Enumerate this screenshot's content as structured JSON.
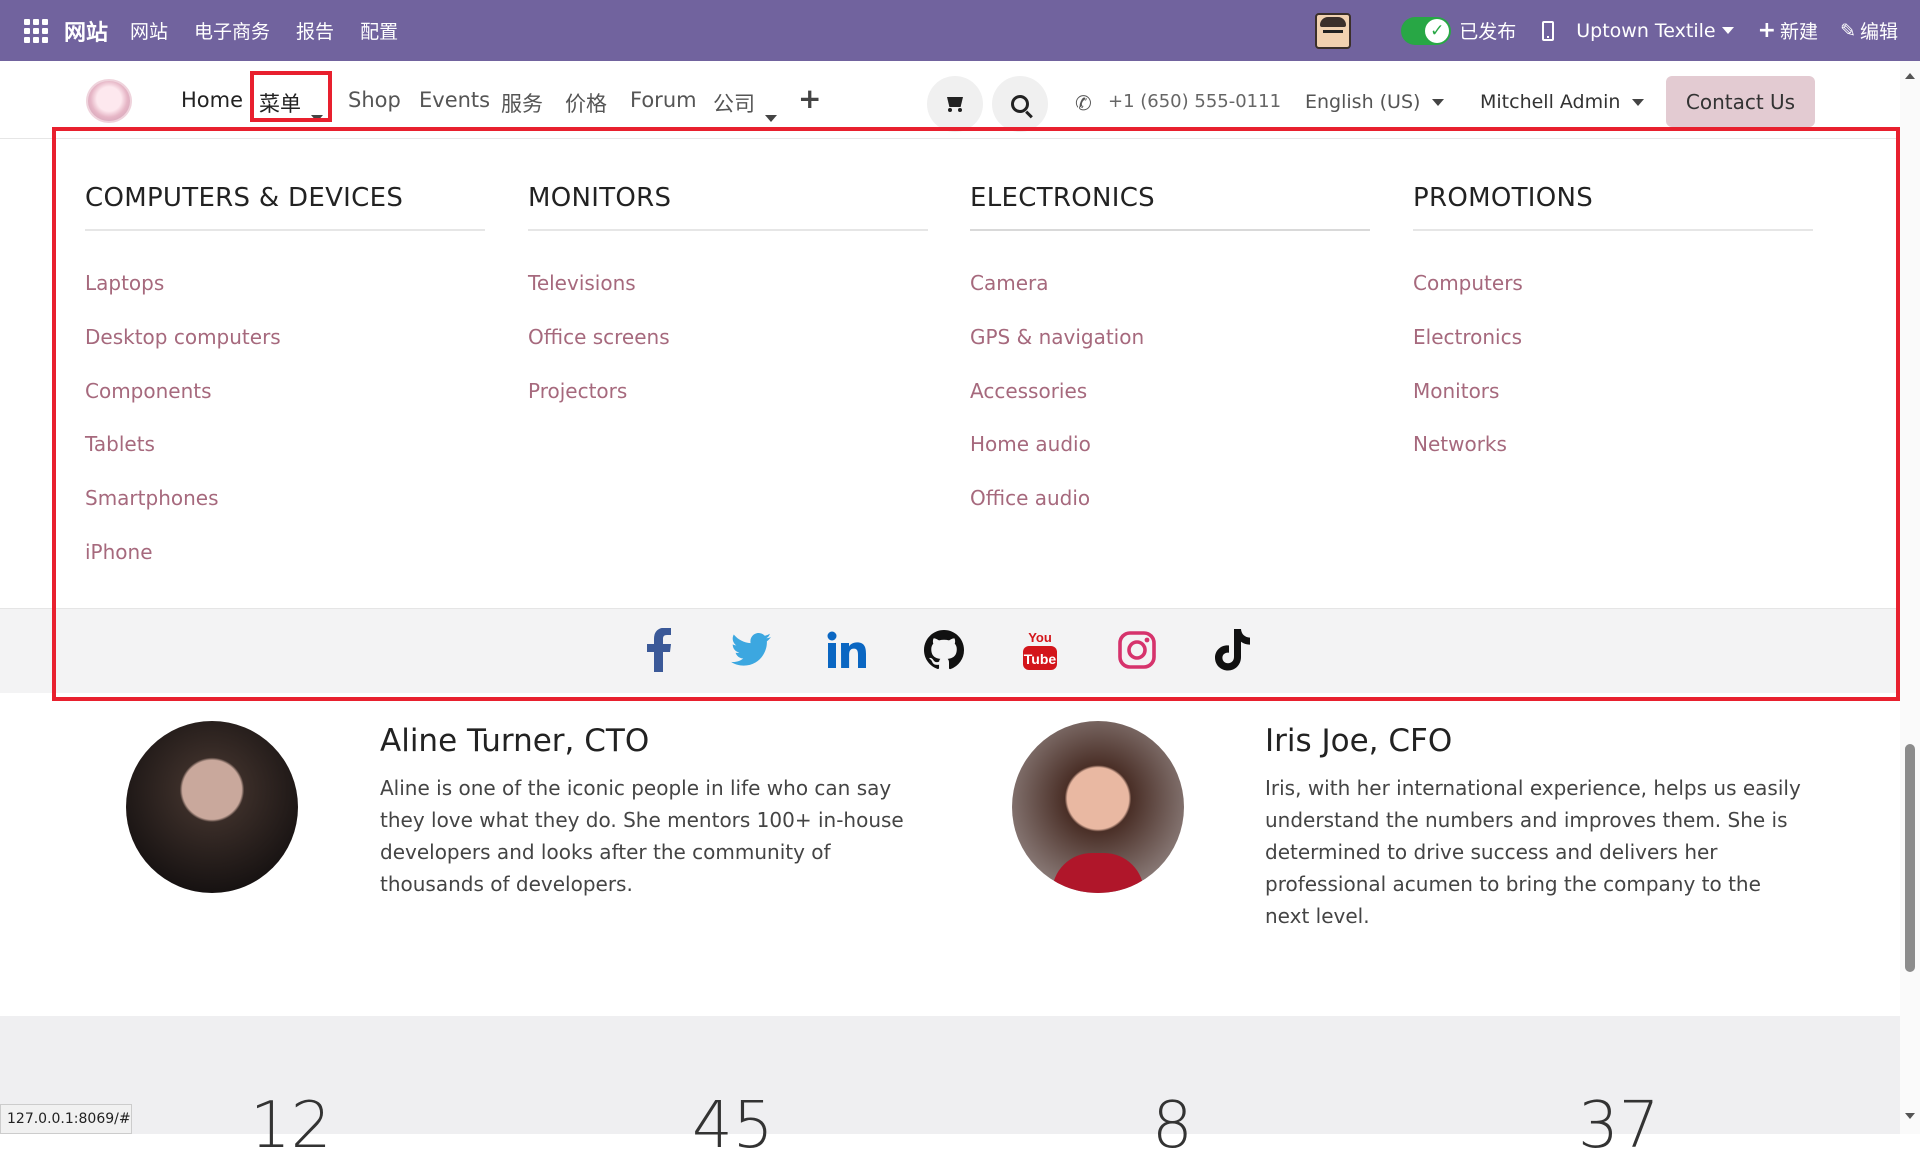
{
  "admin_bar": {
    "brand": "网站",
    "menus": [
      "网站",
      "电子商务",
      "报告",
      "配置"
    ],
    "published": "已发布",
    "site": "Uptown Textile",
    "new": "新建",
    "edit": "编辑",
    "color": "#71639e"
  },
  "navbar": {
    "items": [
      "Home",
      "菜单",
      "Shop",
      "Events",
      "服务",
      "价格",
      "Forum",
      "公司"
    ],
    "phone": "+1 (650) 555-0111",
    "language": "English (US)",
    "user": "Mitchell Admin",
    "contact": "Contact Us",
    "highlighted_item": "菜单"
  },
  "mega_menu": {
    "columns": [
      {
        "title": "COMPUTERS & DEVICES",
        "items": [
          "Laptops",
          "Desktop computers",
          "Components",
          "Tablets",
          "Smartphones",
          "iPhone"
        ]
      },
      {
        "title": "MONITORS",
        "items": [
          "Televisions",
          "Office screens",
          "Projectors"
        ]
      },
      {
        "title": "ELECTRONICS",
        "items": [
          "Camera",
          "GPS & navigation",
          "Accessories",
          "Home audio",
          "Office audio"
        ]
      },
      {
        "title": "PROMOTIONS",
        "items": [
          "Computers",
          "Electronics",
          "Monitors",
          "Networks"
        ]
      }
    ],
    "social_icons": [
      "facebook-icon",
      "twitter-icon",
      "linkedin-icon",
      "github-icon",
      "youtube-icon",
      "instagram-icon",
      "tiktok-icon"
    ],
    "link_color": "#a6697d",
    "highlight_color": "#e8202e"
  },
  "team": [
    {
      "name": "Aline Turner, CTO",
      "bio": "Aline is one of the iconic people in life who can say they love what they do. She mentors 100+ in-house developers and looks after the community of thousands of developers."
    },
    {
      "name": "Iris Joe, CFO",
      "bio": "Iris, with her international experience, helps us easily understand the numbers and improves them. She is determined to drive success and delivers her professional acumen to bring the company to the next level."
    }
  ],
  "stats": [
    "12",
    "45",
    "8",
    "37"
  ],
  "status_url": "127.0.0.1:8069/#"
}
